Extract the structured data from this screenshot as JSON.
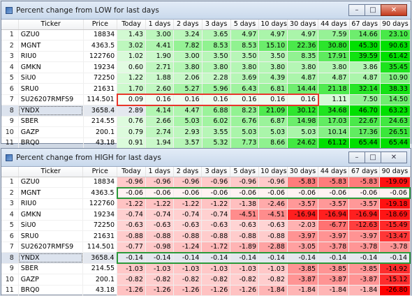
{
  "colors": {
    "low_accent": "#00e000",
    "high_accent": "#e00000"
  },
  "columns": [
    "",
    "Ticker",
    "Price",
    "Today",
    "1 days",
    "2 days",
    "3 days",
    "5 days",
    "10 days",
    "30 days",
    "44 days",
    "67 days",
    "90 days"
  ],
  "low": {
    "title": "Percent change from LOW for last days",
    "rows": [
      [
        "1",
        "GZU0",
        "18834",
        "1.43",
        "3.00",
        "3.24",
        "3.65",
        "4.97",
        "4.97",
        "4.97",
        "7.59",
        "14.66",
        "23.10"
      ],
      [
        "2",
        "MGNT",
        "4363.5",
        "3.02",
        "4.41",
        "7.82",
        "8.53",
        "8.53",
        "15.10",
        "22.36",
        "30.80",
        "45.30",
        "90.63"
      ],
      [
        "3",
        "RIU0",
        "122760",
        "1.02",
        "1.90",
        "3.00",
        "3.50",
        "3.50",
        "3.50",
        "8.35",
        "17.91",
        "39.59",
        "61.42"
      ],
      [
        "4",
        "GMKN",
        "19234",
        "0.60",
        "2.71",
        "3.80",
        "3.80",
        "3.80",
        "3.80",
        "3.80",
        "3.80",
        "3.86",
        "35.45"
      ],
      [
        "5",
        "SiU0",
        "72250",
        "1.22",
        "1.88",
        "2.06",
        "2.28",
        "3.69",
        "4.39",
        "4.87",
        "4.87",
        "4.87",
        "10.90"
      ],
      [
        "6",
        "SRU0",
        "21631",
        "1.70",
        "2.60",
        "5.27",
        "5.96",
        "6.43",
        "6.81",
        "14.44",
        "21.18",
        "32.14",
        "38.33"
      ],
      [
        "7",
        "SU26207RMFS9",
        "114.501",
        "0.09",
        "0.16",
        "0.16",
        "0.16",
        "0.16",
        "0.16",
        "0.16",
        "1.11",
        "7.50",
        "14.50"
      ],
      [
        "8",
        "YNDX",
        "3658.4",
        "2.89",
        "4.14",
        "4.47",
        "6.88",
        "8.23",
        "21.09",
        "30.12",
        "34.68",
        "46.70",
        "63.23"
      ],
      [
        "9",
        "SBER",
        "214.55",
        "0.76",
        "2.66",
        "5.03",
        "6.02",
        "6.76",
        "6.87",
        "14.98",
        "17.03",
        "22.67",
        "24.63"
      ],
      [
        "10",
        "GAZP",
        "200.1",
        "0.79",
        "2.74",
        "2.93",
        "3.55",
        "5.03",
        "5.03",
        "5.03",
        "10.14",
        "17.36",
        "26.51"
      ],
      [
        "11",
        "BRQ0",
        "43.18",
        "0.91",
        "1.94",
        "3.57",
        "5.32",
        "7.73",
        "8.66",
        "24.62",
        "61.12",
        "65.44",
        "65.44"
      ]
    ]
  },
  "high": {
    "title": "Percent change from HIGH for last days",
    "rows": [
      [
        "1",
        "GZU0",
        "18834",
        "-0.96",
        "-0.96",
        "-0.96",
        "-0.96",
        "-0.96",
        "-0.96",
        "-5.83",
        "-5.83",
        "-5.83",
        "-19.09"
      ],
      [
        "2",
        "MGNT",
        "4363.5",
        "-0.06",
        "-0.06",
        "-0.06",
        "-0.06",
        "-0.06",
        "-0.06",
        "-0.06",
        "-0.06",
        "-0.06",
        "-0.06"
      ],
      [
        "3",
        "RIU0",
        "122760",
        "-1.22",
        "-1.22",
        "-1.22",
        "-1.22",
        "-1.38",
        "-2.46",
        "-3.57",
        "-3.57",
        "-3.57",
        "-19.18"
      ],
      [
        "4",
        "GMKN",
        "19234",
        "-0.74",
        "-0.74",
        "-0.74",
        "-0.74",
        "-4.51",
        "-4.51",
        "-16.94",
        "-16.94",
        "-16.94",
        "-18.69"
      ],
      [
        "5",
        "SiU0",
        "72250",
        "-0.63",
        "-0.63",
        "-0.63",
        "-0.63",
        "-0.63",
        "-0.63",
        "-2.03",
        "-6.77",
        "-12.63",
        "-15.49"
      ],
      [
        "6",
        "SRU0",
        "21631",
        "-0.88",
        "-0.88",
        "-0.88",
        "-0.88",
        "-0.88",
        "-0.88",
        "-3.97",
        "-3.97",
        "-3.97",
        "-13.47"
      ],
      [
        "7",
        "SU26207RMFS9",
        "114.501",
        "-0.77",
        "-0.98",
        "-1.24",
        "-1.72",
        "-1.89",
        "-2.88",
        "-3.05",
        "-3.78",
        "-3.78",
        "-3.78"
      ],
      [
        "8",
        "YNDX",
        "3658.4",
        "-0.14",
        "-0.14",
        "-0.14",
        "-0.14",
        "-0.14",
        "-0.14",
        "-0.14",
        "-0.14",
        "-0.14",
        "-0.14"
      ],
      [
        "9",
        "SBER",
        "214.55",
        "-1.03",
        "-1.03",
        "-1.03",
        "-1.03",
        "-1.03",
        "-1.03",
        "-3.85",
        "-3.85",
        "-3.85",
        "-14.92"
      ],
      [
        "10",
        "GAZP",
        "200.1",
        "-0.82",
        "-0.82",
        "-0.82",
        "-0.82",
        "-0.82",
        "-0.82",
        "-3.87",
        "-3.87",
        "-3.87",
        "-15.12"
      ],
      [
        "11",
        "BRQ0",
        "43.18",
        "-1.26",
        "-1.26",
        "-1.26",
        "-1.26",
        "-1.26",
        "-1.84",
        "-1.84",
        "-1.84",
        "-1.84",
        "-26.80"
      ]
    ]
  },
  "icons": {
    "minimize": "minimize-icon",
    "maximize": "maximize-icon",
    "close": "close-icon"
  }
}
